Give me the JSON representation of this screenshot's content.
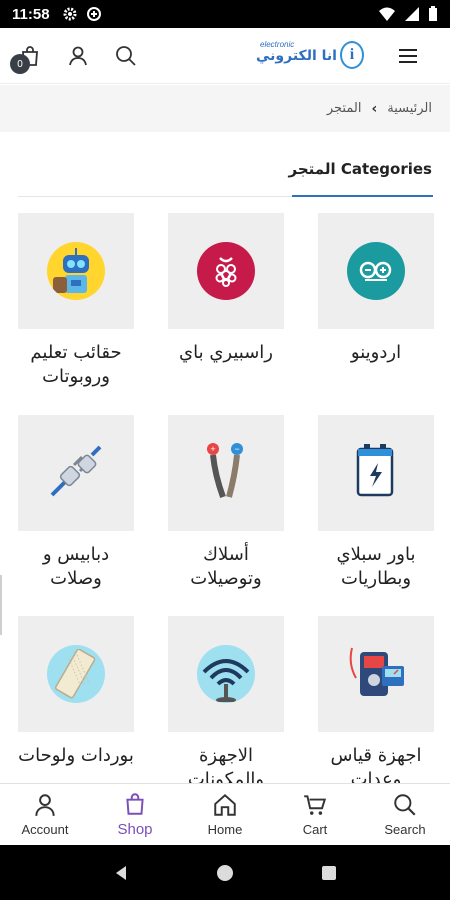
{
  "status_bar": {
    "time": "11:58"
  },
  "header": {
    "cart_count": "0",
    "logo_text": "انا الكتروني",
    "logo_small": "electronic"
  },
  "breadcrumb": {
    "home": "الرئيسية",
    "current": "المتجر"
  },
  "section": {
    "title": "المتجر Categories"
  },
  "categories": [
    {
      "label": "اردوينو",
      "icon": "arduino-icon",
      "color": "#1b9aa0"
    },
    {
      "label": "راسبيري باي",
      "icon": "raspberry-pi-icon",
      "color": "#c51a4a"
    },
    {
      "label": "حقائب تعليم وروبوتات",
      "icon": "robot-kit-icon",
      "color": "#ffd52e"
    },
    {
      "label": "باور سبلاي وبطاريات",
      "icon": "battery-icon",
      "color": "#eeeeee"
    },
    {
      "label": "أسلاك وتوصيلات",
      "icon": "wires-icon",
      "color": "#eeeeee"
    },
    {
      "label": "دبابيس و وصلات",
      "icon": "connector-plug-icon",
      "color": "#eeeeee"
    },
    {
      "label": "اجهزة قياس وعدات",
      "icon": "multimeter-icon",
      "color": "#eeeeee"
    },
    {
      "label": "الاجهزة والمكونات",
      "icon": "wireless-module-icon",
      "color": "#9edff0"
    },
    {
      "label": "بوردات ولوحات",
      "icon": "breadboard-icon",
      "color": "#9edff0"
    }
  ],
  "bottom_nav": [
    {
      "label": "Account",
      "icon": "account-icon"
    },
    {
      "label": "Shop",
      "icon": "shop-bag-icon",
      "active": true
    },
    {
      "label": "Home",
      "icon": "home-icon"
    },
    {
      "label": "Cart",
      "icon": "cart-icon"
    },
    {
      "label": "Search",
      "icon": "search-icon"
    }
  ]
}
